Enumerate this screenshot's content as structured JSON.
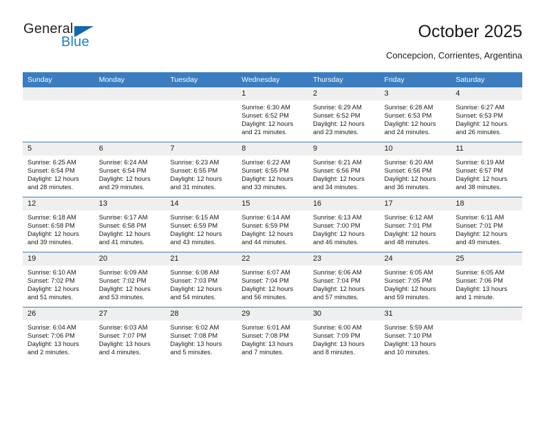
{
  "brand": {
    "name_part1": "General",
    "name_part2": "Blue",
    "logo_icon": "triangle-flag-icon",
    "accent_color": "#1d7fc3",
    "triangle_color": "#1267ad"
  },
  "header": {
    "title": "October 2025",
    "subtitle": "Concepcion, Corrientes, Argentina"
  },
  "theme": {
    "header_row_bg": "#3b7dbf",
    "daynum_bg": "#efefef",
    "grid_line": "#3b7dbf",
    "text": "#1a1a1a"
  },
  "calendar": {
    "weekday_headers": [
      "Sunday",
      "Monday",
      "Tuesday",
      "Wednesday",
      "Thursday",
      "Friday",
      "Saturday"
    ],
    "weeks": [
      [
        {
          "day": "",
          "blank": true,
          "lines": []
        },
        {
          "day": "",
          "blank": true,
          "lines": []
        },
        {
          "day": "",
          "blank": true,
          "lines": []
        },
        {
          "day": "1",
          "blank": false,
          "lines": [
            "Sunrise: 6:30 AM",
            "Sunset: 6:52 PM",
            "Daylight: 12 hours",
            "and 21 minutes."
          ]
        },
        {
          "day": "2",
          "blank": false,
          "lines": [
            "Sunrise: 6:29 AM",
            "Sunset: 6:52 PM",
            "Daylight: 12 hours",
            "and 23 minutes."
          ]
        },
        {
          "day": "3",
          "blank": false,
          "lines": [
            "Sunrise: 6:28 AM",
            "Sunset: 6:53 PM",
            "Daylight: 12 hours",
            "and 24 minutes."
          ]
        },
        {
          "day": "4",
          "blank": false,
          "lines": [
            "Sunrise: 6:27 AM",
            "Sunset: 6:53 PM",
            "Daylight: 12 hours",
            "and 26 minutes."
          ]
        }
      ],
      [
        {
          "day": "5",
          "blank": false,
          "lines": [
            "Sunrise: 6:25 AM",
            "Sunset: 6:54 PM",
            "Daylight: 12 hours",
            "and 28 minutes."
          ]
        },
        {
          "day": "6",
          "blank": false,
          "lines": [
            "Sunrise: 6:24 AM",
            "Sunset: 6:54 PM",
            "Daylight: 12 hours",
            "and 29 minutes."
          ]
        },
        {
          "day": "7",
          "blank": false,
          "lines": [
            "Sunrise: 6:23 AM",
            "Sunset: 6:55 PM",
            "Daylight: 12 hours",
            "and 31 minutes."
          ]
        },
        {
          "day": "8",
          "blank": false,
          "lines": [
            "Sunrise: 6:22 AM",
            "Sunset: 6:55 PM",
            "Daylight: 12 hours",
            "and 33 minutes."
          ]
        },
        {
          "day": "9",
          "blank": false,
          "lines": [
            "Sunrise: 6:21 AM",
            "Sunset: 6:56 PM",
            "Daylight: 12 hours",
            "and 34 minutes."
          ]
        },
        {
          "day": "10",
          "blank": false,
          "lines": [
            "Sunrise: 6:20 AM",
            "Sunset: 6:56 PM",
            "Daylight: 12 hours",
            "and 36 minutes."
          ]
        },
        {
          "day": "11",
          "blank": false,
          "lines": [
            "Sunrise: 6:19 AM",
            "Sunset: 6:57 PM",
            "Daylight: 12 hours",
            "and 38 minutes."
          ]
        }
      ],
      [
        {
          "day": "12",
          "blank": false,
          "lines": [
            "Sunrise: 6:18 AM",
            "Sunset: 6:58 PM",
            "Daylight: 12 hours",
            "and 39 minutes."
          ]
        },
        {
          "day": "13",
          "blank": false,
          "lines": [
            "Sunrise: 6:17 AM",
            "Sunset: 6:58 PM",
            "Daylight: 12 hours",
            "and 41 minutes."
          ]
        },
        {
          "day": "14",
          "blank": false,
          "lines": [
            "Sunrise: 6:15 AM",
            "Sunset: 6:59 PM",
            "Daylight: 12 hours",
            "and 43 minutes."
          ]
        },
        {
          "day": "15",
          "blank": false,
          "lines": [
            "Sunrise: 6:14 AM",
            "Sunset: 6:59 PM",
            "Daylight: 12 hours",
            "and 44 minutes."
          ]
        },
        {
          "day": "16",
          "blank": false,
          "lines": [
            "Sunrise: 6:13 AM",
            "Sunset: 7:00 PM",
            "Daylight: 12 hours",
            "and 46 minutes."
          ]
        },
        {
          "day": "17",
          "blank": false,
          "lines": [
            "Sunrise: 6:12 AM",
            "Sunset: 7:01 PM",
            "Daylight: 12 hours",
            "and 48 minutes."
          ]
        },
        {
          "day": "18",
          "blank": false,
          "lines": [
            "Sunrise: 6:11 AM",
            "Sunset: 7:01 PM",
            "Daylight: 12 hours",
            "and 49 minutes."
          ]
        }
      ],
      [
        {
          "day": "19",
          "blank": false,
          "lines": [
            "Sunrise: 6:10 AM",
            "Sunset: 7:02 PM",
            "Daylight: 12 hours",
            "and 51 minutes."
          ]
        },
        {
          "day": "20",
          "blank": false,
          "lines": [
            "Sunrise: 6:09 AM",
            "Sunset: 7:02 PM",
            "Daylight: 12 hours",
            "and 53 minutes."
          ]
        },
        {
          "day": "21",
          "blank": false,
          "lines": [
            "Sunrise: 6:08 AM",
            "Sunset: 7:03 PM",
            "Daylight: 12 hours",
            "and 54 minutes."
          ]
        },
        {
          "day": "22",
          "blank": false,
          "lines": [
            "Sunrise: 6:07 AM",
            "Sunset: 7:04 PM",
            "Daylight: 12 hours",
            "and 56 minutes."
          ]
        },
        {
          "day": "23",
          "blank": false,
          "lines": [
            "Sunrise: 6:06 AM",
            "Sunset: 7:04 PM",
            "Daylight: 12 hours",
            "and 57 minutes."
          ]
        },
        {
          "day": "24",
          "blank": false,
          "lines": [
            "Sunrise: 6:05 AM",
            "Sunset: 7:05 PM",
            "Daylight: 12 hours",
            "and 59 minutes."
          ]
        },
        {
          "day": "25",
          "blank": false,
          "lines": [
            "Sunrise: 6:05 AM",
            "Sunset: 7:06 PM",
            "Daylight: 13 hours",
            "and 1 minute."
          ]
        }
      ],
      [
        {
          "day": "26",
          "blank": false,
          "lines": [
            "Sunrise: 6:04 AM",
            "Sunset: 7:06 PM",
            "Daylight: 13 hours",
            "and 2 minutes."
          ]
        },
        {
          "day": "27",
          "blank": false,
          "lines": [
            "Sunrise: 6:03 AM",
            "Sunset: 7:07 PM",
            "Daylight: 13 hours",
            "and 4 minutes."
          ]
        },
        {
          "day": "28",
          "blank": false,
          "lines": [
            "Sunrise: 6:02 AM",
            "Sunset: 7:08 PM",
            "Daylight: 13 hours",
            "and 5 minutes."
          ]
        },
        {
          "day": "29",
          "blank": false,
          "lines": [
            "Sunrise: 6:01 AM",
            "Sunset: 7:08 PM",
            "Daylight: 13 hours",
            "and 7 minutes."
          ]
        },
        {
          "day": "30",
          "blank": false,
          "lines": [
            "Sunrise: 6:00 AM",
            "Sunset: 7:09 PM",
            "Daylight: 13 hours",
            "and 8 minutes."
          ]
        },
        {
          "day": "31",
          "blank": false,
          "lines": [
            "Sunrise: 5:59 AM",
            "Sunset: 7:10 PM",
            "Daylight: 13 hours",
            "and 10 minutes."
          ]
        },
        {
          "day": "",
          "blank": true,
          "lines": []
        }
      ]
    ]
  }
}
